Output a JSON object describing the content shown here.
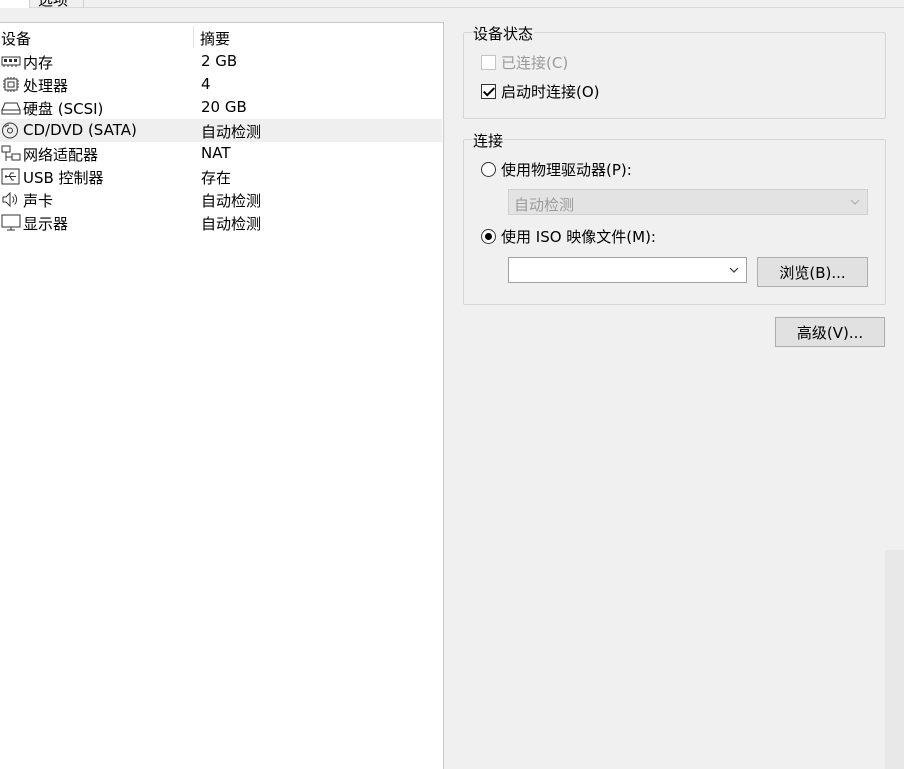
{
  "tabs": [
    {
      "label": ""
    },
    {
      "label": "选项"
    }
  ],
  "device_list": {
    "columns": {
      "device": "设备",
      "summary": "摘要"
    },
    "rows": [
      {
        "icon": "memory-icon",
        "name": "内存",
        "summary": "2 GB",
        "selected": false
      },
      {
        "icon": "processor-icon",
        "name": "处理器",
        "summary": "4",
        "selected": false
      },
      {
        "icon": "hard-disk-icon",
        "name": "硬盘 (SCSI)",
        "summary": "20 GB",
        "selected": false
      },
      {
        "icon": "cd-dvd-icon",
        "name": "CD/DVD (SATA)",
        "summary": "自动检测",
        "selected": true
      },
      {
        "icon": "network-adapter-icon",
        "name": "网络适配器",
        "summary": "NAT",
        "selected": false
      },
      {
        "icon": "usb-icon",
        "name": "USB 控制器",
        "summary": "存在",
        "selected": false
      },
      {
        "icon": "sound-icon",
        "name": "声卡",
        "summary": "自动检测",
        "selected": false
      },
      {
        "icon": "display-icon",
        "name": "显示器",
        "summary": "自动检测",
        "selected": false
      }
    ]
  },
  "device_status": {
    "title": "设备状态",
    "connected_label": "已连接(C)",
    "connected_checked": false,
    "connected_enabled": false,
    "connect_at_poweron_label": "启动时连接(O)",
    "connect_at_poweron_checked": true
  },
  "connection": {
    "title": "连接",
    "physical_drive_label": "使用物理驱动器(P):",
    "physical_drive_selected": false,
    "physical_drive_value": "自动检测",
    "iso_label": "使用 ISO 映像文件(M):",
    "iso_selected": true,
    "iso_path_value": "",
    "browse_label": "浏览(B)..."
  },
  "advanced_label": "高级(V)..."
}
